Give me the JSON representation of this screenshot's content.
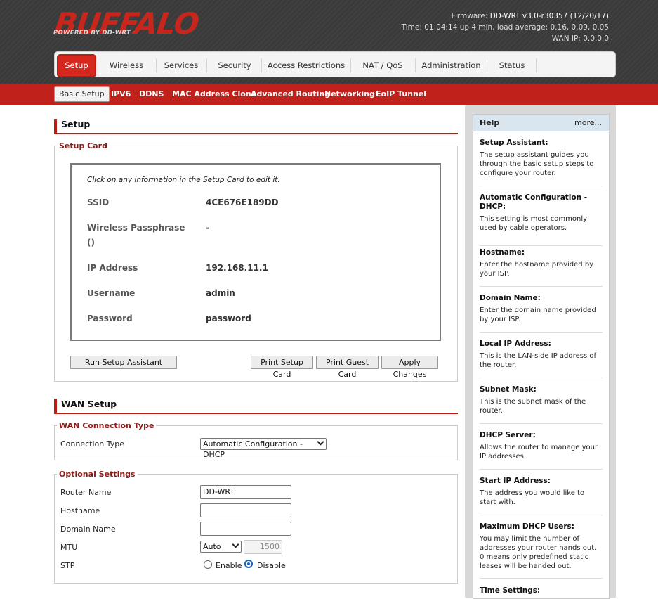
{
  "header": {
    "logo": "BUFFALO",
    "logo_sub": "POWERED BY DD-WRT",
    "firmware_label": "Firmware:",
    "firmware_value": "DD-WRT v3.0-r30357 (12/20/17)",
    "time_label": "Time:",
    "time_value": "01:04:14 up 4 min, load average: 0.16, 0.09, 0.05",
    "wanip_label": "WAN IP:",
    "wanip_value": "0.0.0.0"
  },
  "tabs": [
    "Setup",
    "Wireless",
    "Services",
    "Security",
    "Access Restrictions",
    "NAT / QoS",
    "Administration",
    "Status"
  ],
  "subtabs": [
    "Basic Setup",
    "IPV6",
    "DDNS",
    "MAC Address Clone",
    "Advanced Routing",
    "Networking",
    "EoIP Tunnel"
  ],
  "setup": {
    "title": "Setup",
    "card_legend": "Setup Card",
    "card_note": "Click on any information in the Setup Card to edit it.",
    "rows": [
      {
        "label": "SSID",
        "value": "4CE676E189DD"
      },
      {
        "label": "Wireless Passphrase ()",
        "value": "-"
      },
      {
        "label": "IP Address",
        "value": "192.168.11.1"
      },
      {
        "label": "Username",
        "value": "admin"
      },
      {
        "label": "Password",
        "value": "password"
      }
    ],
    "buttons": {
      "run_assistant": "Run Setup Assistant",
      "print_card": "Print Setup Card",
      "print_guest": "Print Guest Card",
      "apply": "Apply Changes"
    }
  },
  "wan": {
    "title": "WAN Setup",
    "conn_legend": "WAN Connection Type",
    "conn_label": "Connection Type",
    "conn_value": "Automatic Configuration - DHCP",
    "opt_legend": "Optional Settings",
    "router_name_label": "Router Name",
    "router_name_value": "DD-WRT",
    "hostname_label": "Hostname",
    "hostname_value": "",
    "domain_label": "Domain Name",
    "domain_value": "",
    "mtu_label": "MTU",
    "mtu_mode": "Auto",
    "mtu_value": "1500",
    "stp_label": "STP",
    "stp_enable": "Enable",
    "stp_disable": "Disable",
    "stp_selected": "Disable"
  },
  "help": {
    "title": "Help",
    "more": "more...",
    "items": [
      {
        "title": "Setup Assistant:",
        "desc": "The setup assistant guides you through the basic setup steps to configure your router."
      },
      {
        "title": "Automatic Configuration - DHCP:",
        "desc": "This setting is most commonly used by cable operators."
      },
      {
        "title": "Hostname:",
        "desc": "Enter the hostname provided by your ISP."
      },
      {
        "title": "Domain Name:",
        "desc": "Enter the domain name provided by your ISP."
      },
      {
        "title": "Local IP Address:",
        "desc": "This is the LAN-side IP address of the router."
      },
      {
        "title": "Subnet Mask:",
        "desc": "This is the subnet mask of the router."
      },
      {
        "title": "DHCP Server:",
        "desc": "Allows the router to manage your IP addresses."
      },
      {
        "title": "Start IP Address:",
        "desc": "The address you would like to start with."
      },
      {
        "title": "Maximum DHCP Users:",
        "desc": "You may limit the number of addresses your router hands out. 0 means only predefined static leases will be handed out."
      },
      {
        "title": "Time Settings:",
        "desc": ""
      }
    ]
  },
  "colors": {
    "accent_red": "#c0211a",
    "header_dark": "#3a3a3a",
    "help_head": "#d9e6ef"
  }
}
